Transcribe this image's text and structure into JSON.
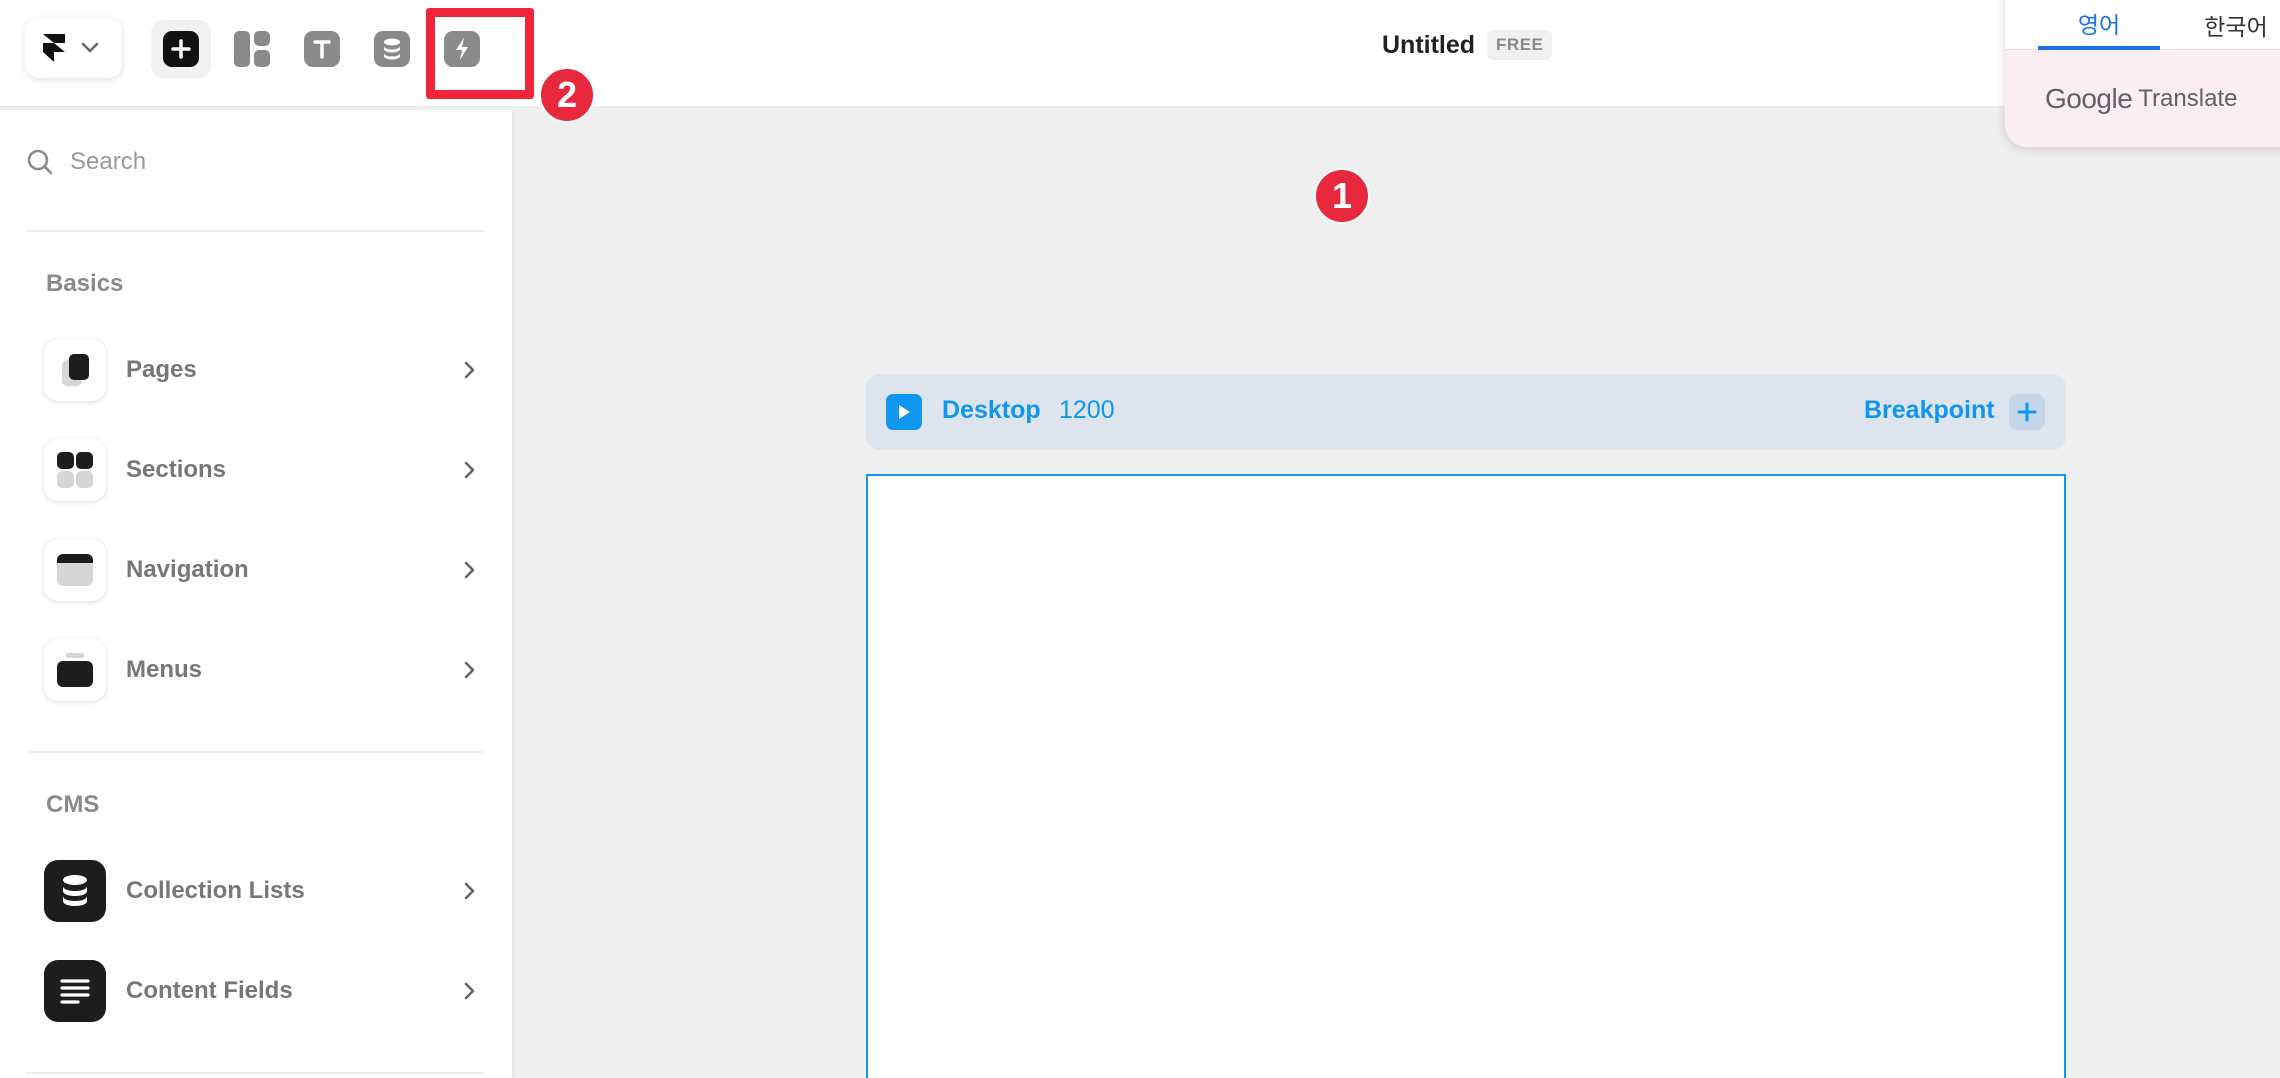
{
  "toolbar": {
    "logo_icon": "framer-logo-icon",
    "tools": [
      {
        "name": "insert",
        "icon": "plus-icon"
      },
      {
        "name": "layout",
        "icon": "layout-icon"
      },
      {
        "name": "text",
        "icon": "text-icon"
      },
      {
        "name": "cms",
        "icon": "database-icon"
      },
      {
        "name": "plugins",
        "icon": "bolt-icon"
      }
    ]
  },
  "annotations": {
    "badge1": "1",
    "badge2": "2"
  },
  "header": {
    "title": "Untitled",
    "plan_badge": "FREE"
  },
  "translate_popup": {
    "tabs": [
      "영어",
      "한국어"
    ],
    "active_tab": "영어",
    "brand_google": "Google",
    "brand_translate": "Translate"
  },
  "sidebar": {
    "search_placeholder": "Search",
    "sections": [
      {
        "title": "Basics",
        "items": [
          {
            "label": "Pages",
            "icon": "pages-icon"
          },
          {
            "label": "Sections",
            "icon": "sections-icon"
          },
          {
            "label": "Navigation",
            "icon": "navigation-icon"
          },
          {
            "label": "Menus",
            "icon": "menus-icon"
          }
        ]
      },
      {
        "title": "CMS",
        "items": [
          {
            "label": "Collection Lists",
            "icon": "database-icon"
          },
          {
            "label": "Content Fields",
            "icon": "text-lines-icon"
          }
        ]
      }
    ]
  },
  "canvas": {
    "breakpoint_name": "Desktop",
    "breakpoint_width": "1200",
    "breakpoint_label": "Breakpoint"
  },
  "colors": {
    "accent": "#0f96f0",
    "annotation_red": "#e8283d",
    "google_blue": "#1a73e8"
  }
}
